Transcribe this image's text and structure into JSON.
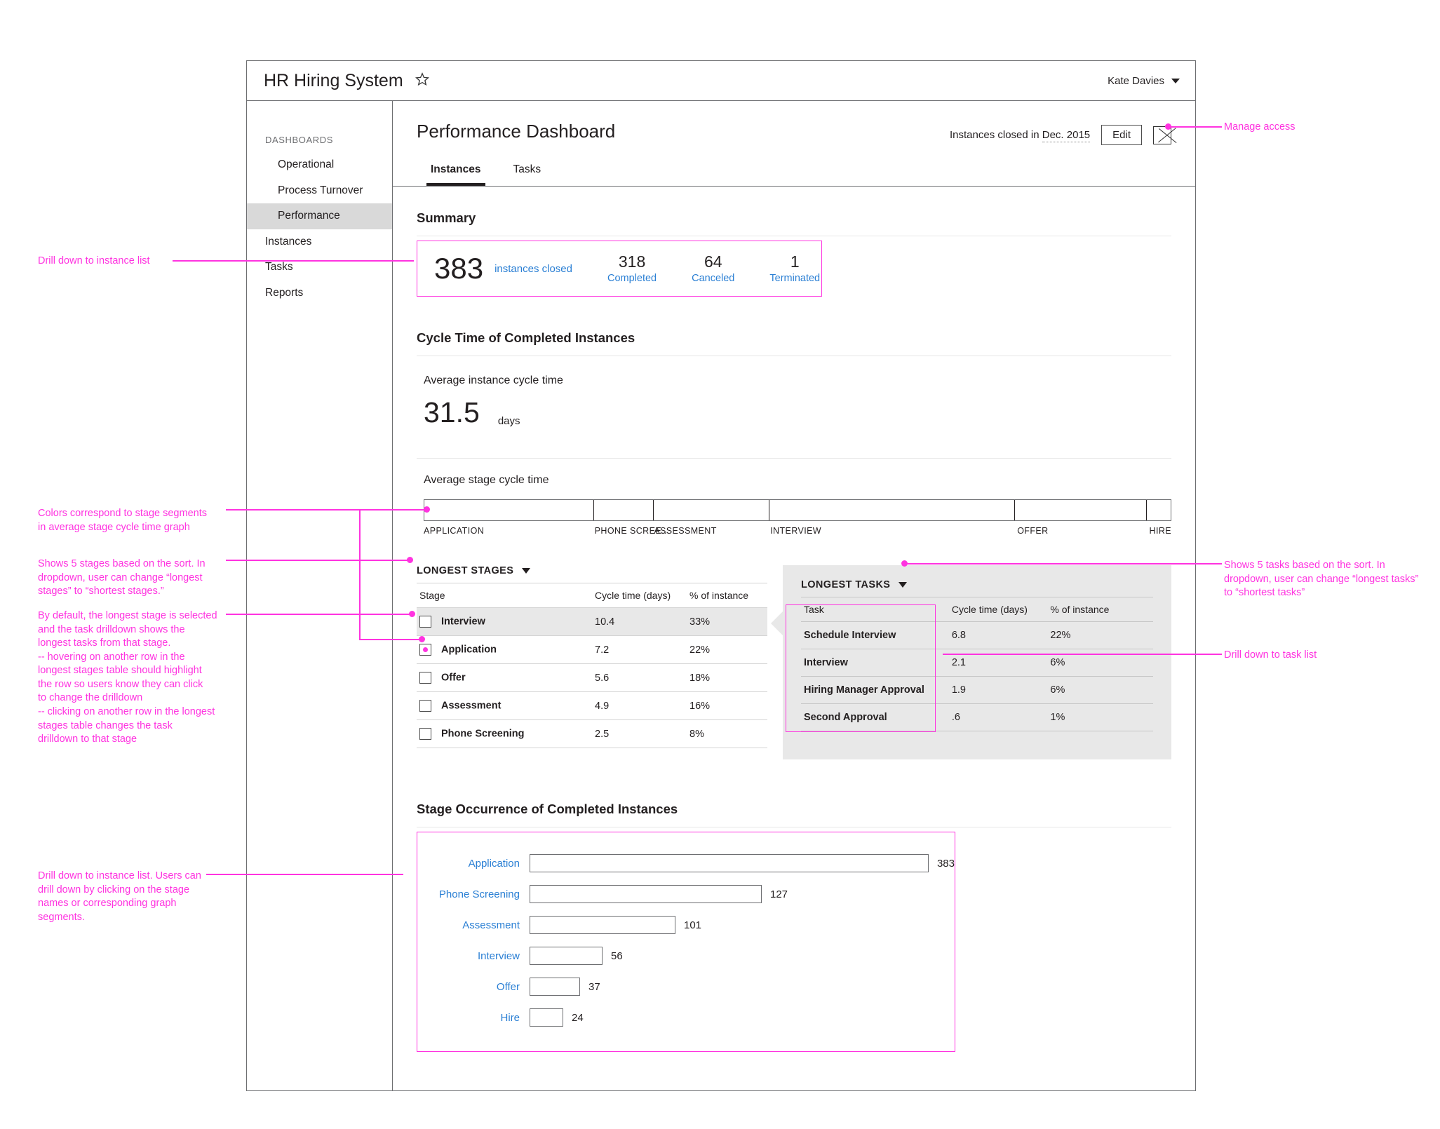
{
  "titlebar": {
    "app_title": "HR Hiring System",
    "star_icon": "star-outline-icon",
    "user_name": "Kate Davies"
  },
  "sidebar": {
    "group_label": "DASHBOARDS",
    "items": [
      {
        "label": "Operational",
        "sub": true,
        "active": false
      },
      {
        "label": "Process Turnover",
        "sub": true,
        "active": false
      },
      {
        "label": "Performance",
        "sub": true,
        "active": true
      },
      {
        "label": "Instances",
        "sub": false,
        "active": false
      },
      {
        "label": "Tasks",
        "sub": false,
        "active": false
      },
      {
        "label": "Reports",
        "sub": false,
        "active": false
      }
    ]
  },
  "header": {
    "page_title": "Performance Dashboard",
    "filter_prefix": "Instances closed in ",
    "filter_value": "Dec. 2015",
    "edit_label": "Edit",
    "access_icon": "manage-access-icon",
    "tabs": [
      {
        "label": "Instances",
        "active": true
      },
      {
        "label": "Tasks",
        "active": false
      }
    ]
  },
  "summary": {
    "title": "Summary",
    "total": "383",
    "total_label": "instances closed",
    "stats": [
      {
        "value": "318",
        "label": "Completed"
      },
      {
        "value": "64",
        "label": "Canceled"
      },
      {
        "value": "1",
        "label": "Terminated"
      }
    ]
  },
  "cycle_time": {
    "title": "Cycle Time of Completed Instances",
    "avg_label": "Average instance cycle time",
    "avg_value": "31.5",
    "avg_unit": "days",
    "stage_graph_label": "Average stage cycle time"
  },
  "drilldown": {
    "stages": {
      "panel_label": "LONGEST STAGES",
      "columns": [
        "Stage",
        "Cycle time (days)",
        "% of instance"
      ],
      "rows": [
        {
          "name": "Interview",
          "cycle": "10.4",
          "pct": "33%",
          "selected": true,
          "marked": false
        },
        {
          "name": "Application",
          "cycle": "7.2",
          "pct": "22%",
          "selected": false,
          "marked": true
        },
        {
          "name": "Offer",
          "cycle": "5.6",
          "pct": "18%",
          "selected": false,
          "marked": false
        },
        {
          "name": "Assessment",
          "cycle": "4.9",
          "pct": "16%",
          "selected": false,
          "marked": false
        },
        {
          "name": "Phone Screening",
          "cycle": "2.5",
          "pct": "8%",
          "selected": false,
          "marked": false
        }
      ]
    },
    "tasks": {
      "panel_label": "LONGEST TASKS",
      "columns": [
        "Task",
        "Cycle time (days)",
        "% of instance"
      ],
      "rows": [
        {
          "name": "Schedule Interview",
          "cycle": "6.8",
          "pct": "22%"
        },
        {
          "name": "Interview",
          "cycle": "2.1",
          "pct": "6%"
        },
        {
          "name": "Hiring Manager Approval",
          "cycle": "1.9",
          "pct": "6%"
        },
        {
          "name": "Second Approval",
          "cycle": ".6",
          "pct": "1%"
        }
      ]
    }
  },
  "occurrence": {
    "title": "Stage Occurrence of Completed Instances"
  },
  "annotations": [
    {
      "id": "a-instance-list",
      "text": "Drill down to instance list"
    },
    {
      "id": "a-colors",
      "text": "Colors correspond to stage segments\nin average stage cycle time graph"
    },
    {
      "id": "a-five-stages",
      "text": "Shows 5 stages based on the sort. In\ndropdown, user can change “longest\nstages” to “shortest stages.”"
    },
    {
      "id": "a-default-stage",
      "text": "By default, the longest stage is selected\nand the task drilldown shows the\nlongest tasks from that stage.\n      -- hovering on another row in the\n         longest stages table should highlight\n         the row so users know they can click\n         to change the drilldown\n      -- clicking on another row in the longest\n         stages table changes the task\n         drilldown to that stage"
    },
    {
      "id": "a-occurrence",
      "text": "Drill down to instance list. Users can\ndrill down by clicking on the stage\nnames or corresponding graph\nsegments."
    },
    {
      "id": "a-manage-access",
      "text": "Manage access"
    },
    {
      "id": "a-five-tasks",
      "text": "Shows 5 tasks based on the sort. In\ndropdown, user can change “longest tasks”\nto “shortest tasks”"
    },
    {
      "id": "a-task-list",
      "text": "Drill down to task list"
    }
  ],
  "chart_data": [
    {
      "type": "bar",
      "orientation": "horizontal-stacked",
      "title": "Average stage cycle time",
      "categories": [
        "APPLICATION",
        "PHONE SCREE...",
        "ASSESSMENT",
        "INTERVIEW",
        "OFFER",
        "HIRE"
      ],
      "values": [
        7.2,
        2.5,
        4.9,
        10.4,
        5.6,
        1.0
      ],
      "unit": "days",
      "total": 31.5,
      "xlabel": "",
      "ylabel": "",
      "grid": false,
      "legend": "none"
    },
    {
      "type": "bar",
      "orientation": "horizontal",
      "title": "Stage Occurrence of Completed Instances",
      "categories": [
        "Application",
        "Phone Screening",
        "Assessment",
        "Interview",
        "Offer",
        "Hire"
      ],
      "values": [
        383,
        127,
        101,
        56,
        37,
        24
      ],
      "xlabel": "",
      "ylabel": "",
      "xlim": [
        0,
        383
      ],
      "grid": false,
      "legend": "none"
    },
    {
      "type": "table",
      "title": "LONGEST STAGES",
      "columns": [
        "Stage",
        "Cycle time (days)",
        "% of instance"
      ],
      "rows": [
        [
          "Interview",
          10.4,
          "33%"
        ],
        [
          "Application",
          7.2,
          "22%"
        ],
        [
          "Offer",
          5.6,
          "18%"
        ],
        [
          "Assessment",
          4.9,
          "16%"
        ],
        [
          "Phone Screening",
          2.5,
          "8%"
        ]
      ]
    },
    {
      "type": "table",
      "title": "LONGEST TASKS",
      "columns": [
        "Task",
        "Cycle time (days)",
        "% of instance"
      ],
      "rows": [
        [
          "Schedule Interview",
          6.8,
          "22%"
        ],
        [
          "Interview",
          2.1,
          "6%"
        ],
        [
          "Hiring Manager Approval",
          1.9,
          "6%"
        ],
        [
          "Second Approval",
          0.6,
          "1%"
        ]
      ]
    }
  ]
}
